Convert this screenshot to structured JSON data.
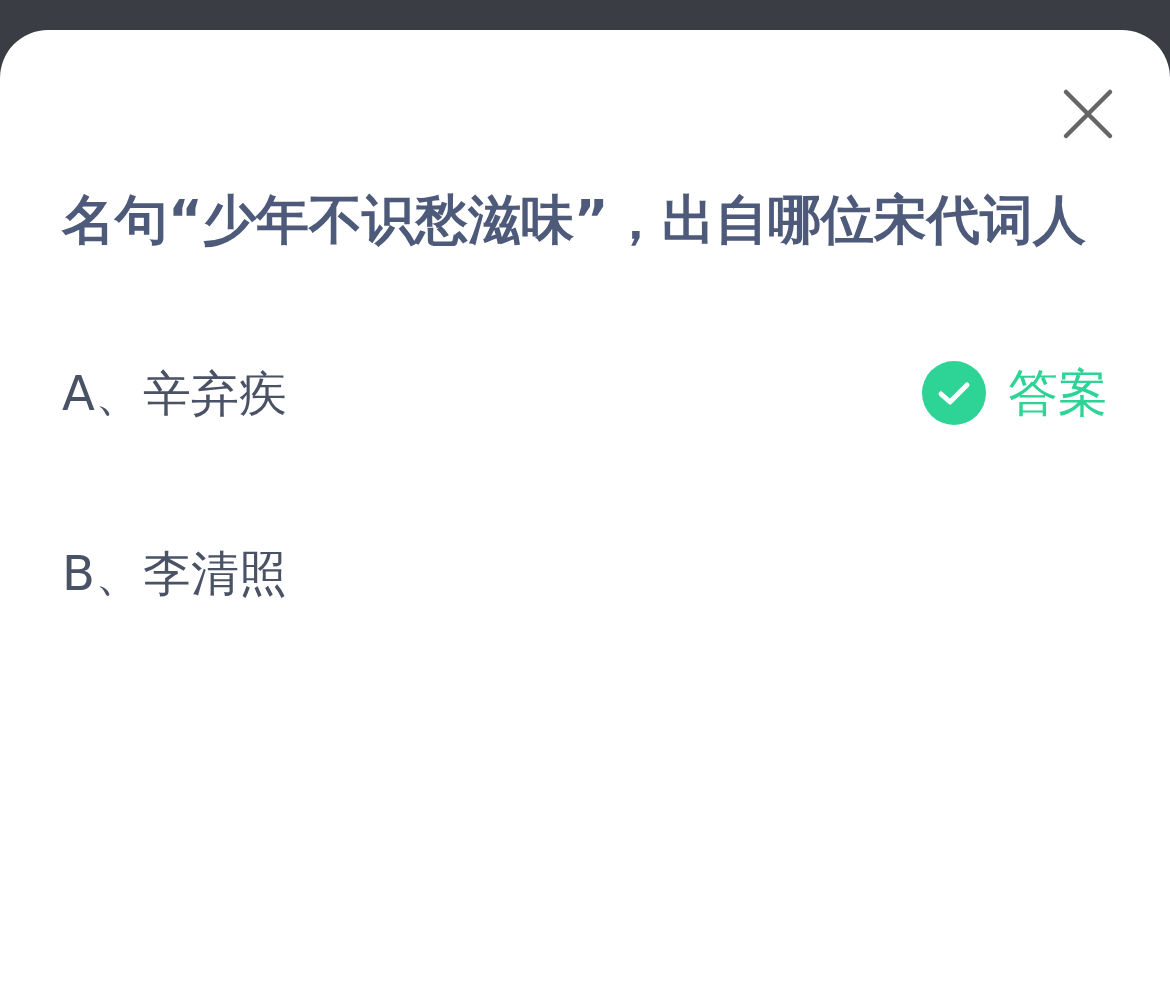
{
  "question": "名句“少年不识愁滋味”，出自哪位宋代词人",
  "options": [
    {
      "letter": "A、",
      "text": "辛弃疾",
      "correct": true,
      "answer_label": "答案"
    },
    {
      "letter": "B、",
      "text": "李清照",
      "correct": false
    }
  ]
}
